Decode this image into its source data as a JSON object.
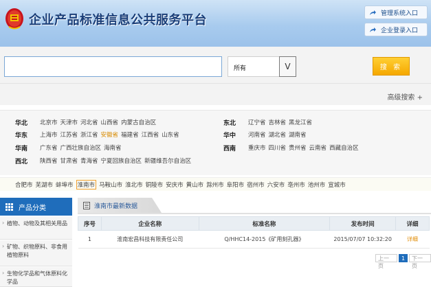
{
  "header": {
    "title": "企业产品标准信息公共服务平台",
    "buttons": [
      "管理系统入口",
      "企业登录入口"
    ]
  },
  "search": {
    "input_value": "",
    "select_value": "所有",
    "select_arrow": "V",
    "button_label": "搜 索",
    "advanced_label": "高级搜索 +"
  },
  "regions": [
    {
      "name": "华北",
      "items": [
        "北京市",
        "天津市",
        "河北省",
        "山西省",
        "内蒙古自治区"
      ]
    },
    {
      "name": "东北",
      "items": [
        "辽宁省",
        "吉林省",
        "黑龙江省"
      ]
    },
    {
      "name": "华东",
      "items": [
        "上海市",
        "江苏省",
        "浙江省",
        "安徽省",
        "福建省",
        "江西省",
        "山东省"
      ],
      "highlight": "安徽省"
    },
    {
      "name": "华中",
      "items": [
        "河南省",
        "湖北省",
        "湖南省"
      ]
    },
    {
      "name": "华南",
      "items": [
        "广东省",
        "广西壮族自治区",
        "海南省"
      ]
    },
    {
      "name": "西南",
      "items": [
        "重庆市",
        "四川省",
        "贵州省",
        "云南省",
        "西藏自治区"
      ]
    },
    {
      "name": "西北",
      "items": [
        "陕西省",
        "甘肃省",
        "青海省",
        "宁夏回族自治区",
        "新疆维吾尔自治区"
      ]
    }
  ],
  "cities": [
    "合肥市",
    "芜湖市",
    "蚌埠市",
    "淮南市",
    "马鞍山市",
    "淮北市",
    "铜陵市",
    "安庆市",
    "黄山市",
    "滁州市",
    "阜阳市",
    "宿州市",
    "六安市",
    "亳州市",
    "池州市",
    "宣城市"
  ],
  "active_city": "淮南市",
  "sidebar": {
    "title": "产品分类",
    "items": [
      "植物、动物及其相关用品",
      "矿物、织物原料、非食用植物原料",
      "生物化学品和气体原料化学品"
    ]
  },
  "panel": {
    "tab_title": "淮南市最新数据",
    "columns": [
      "序号",
      "企业名称",
      "标准名称",
      "发布时间",
      "详细"
    ],
    "rows": [
      {
        "no": "1",
        "company": "淮南宏昌科技有限责任公司",
        "standard": "Q/HHC14-2015《矿用刻孔器》",
        "date": "2015/07/07 10:32:20",
        "detail": "详细"
      }
    ]
  },
  "pager": {
    "prev": "上一页",
    "current": "1",
    "next": "下一页"
  },
  "colors": {
    "header_top": "#cfe3f6",
    "brand_blue": "#1f6dbb",
    "search_button": "#f5a800",
    "highlight": "#d88a00"
  }
}
